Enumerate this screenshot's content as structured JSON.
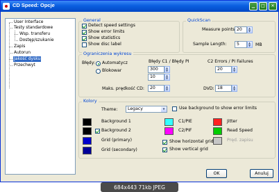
{
  "window": {
    "title": "CD Speed: Opcje"
  },
  "tree": {
    "items": [
      "User Interface",
      "Testy standardowe",
      "Wsp. transferu",
      "Dostęp/szukanie",
      "Zapis",
      "Autorun",
      "Jakość dysku",
      "Przechwyt"
    ],
    "selected": "Jakość dysku"
  },
  "general": {
    "legend": "General",
    "options": [
      {
        "label": "Detect speed settings",
        "checked": true
      },
      {
        "label": "Show error limits",
        "checked": true
      },
      {
        "label": "Show statistics",
        "checked": true
      },
      {
        "label": "Show disc label",
        "checked": false
      }
    ]
  },
  "quickscan": {
    "legend": "QuickScan",
    "measure_points_label": "Measure points",
    "measure_points_value": "20",
    "sample_length_label": "Sample Length:",
    "sample_length_value": "5",
    "sample_length_unit": "MB"
  },
  "limits": {
    "legend": "Ograniczenia wykresu",
    "errors_label": "Błędy:",
    "mode_auto": "Automatycz",
    "mode_block": "Blokowar",
    "mode_selected": "Automatycz",
    "c1_header": "Błędy C1 / Błędy PI",
    "c1_value": "300",
    "c1_value2": "10",
    "c2_header": "C2 Errors / PI Failures",
    "c2_value": "20",
    "max_speed_label": "Maks. prędkość CD:",
    "max_speed_value": "20",
    "dvd_label": "DVD:",
    "dvd_value": "18"
  },
  "colors": {
    "legend": "Kolory",
    "theme_label": "Theme:",
    "theme_value": "Legacy",
    "use_background_label": "Use background to show error limits",
    "use_background_checked": false,
    "entries": [
      {
        "label": "Background 1",
        "color": "#000000"
      },
      {
        "label": "Background 2",
        "color": "#000000"
      },
      {
        "label": "Grid (primary)",
        "color": "#0000cc"
      },
      {
        "label": "Grid (secondary)",
        "color": "#000099"
      },
      {
        "label": "C1/PIE",
        "color": "#33ffff"
      },
      {
        "label": "C2/PIF",
        "color": "#ff00ff"
      },
      {
        "label": "Jitter",
        "color": "#ff2020"
      },
      {
        "label": "Read Speed",
        "color": "#00cc00"
      },
      {
        "label": "Pręd. zapisu",
        "color": "#c6c6c6"
      }
    ],
    "background2_checked": true,
    "show_horizontal_grid": "Show horizontal grid",
    "show_vertical_grid": "Show vertical grid"
  },
  "buttons": {
    "ok": "OK",
    "cancel": "Anuluj"
  },
  "watermark": "684x443 71kb JPEG"
}
